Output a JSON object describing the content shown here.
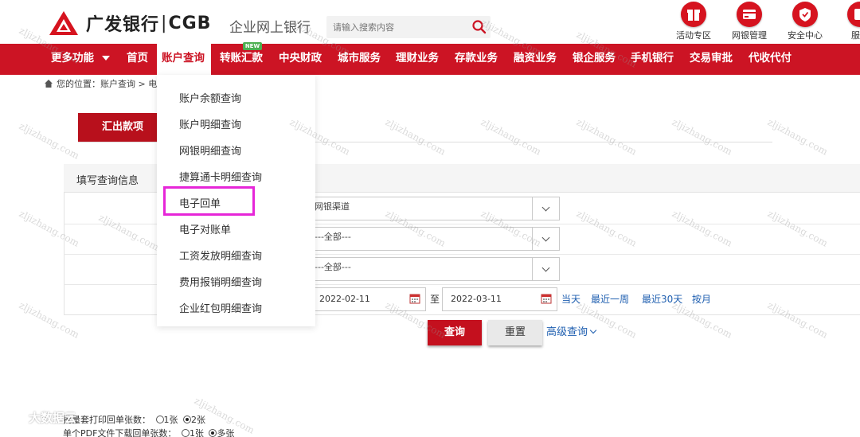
{
  "header": {
    "logo_cn": "广发银行",
    "logo_sep": "|",
    "logo_en": "CGB",
    "site_name": "企业网上银行",
    "search_placeholder": "请输入搜索内容",
    "quick_links": [
      {
        "label": "活动专区",
        "icon": "gift-icon"
      },
      {
        "label": "网银管理",
        "icon": "card-manage-icon"
      },
      {
        "label": "安全中心",
        "icon": "shield-icon"
      },
      {
        "label": "服务",
        "icon": "service-icon"
      }
    ]
  },
  "nav": {
    "more": "更多功能",
    "items": [
      "首页",
      "账户查询",
      "转账汇款",
      "中央财政",
      "城市服务",
      "理财业务",
      "存款业务",
      "融资业务",
      "银企服务",
      "手机银行",
      "交易审批",
      "代收代付"
    ],
    "new_badge": "NEW",
    "active": "账户查询"
  },
  "breadcrumb": {
    "text": "您的位置：账户查询 > 电"
  },
  "main": {
    "tab": "汇出款项",
    "form_title": "填写查询信息",
    "fields": {
      "channel": "网银渠道",
      "select2": "---全部---",
      "select3": "---全部---",
      "date_from": "2022-02-11",
      "date_sep": "至",
      "date_to": "2022-03-11"
    },
    "quick_dates": [
      "当天",
      "最近一周",
      "最近30天",
      "按月"
    ],
    "query_btn": "查询",
    "reset_btn": "重置",
    "advanced": "高级查询"
  },
  "dropdown": {
    "items": [
      "账户余额查询",
      "账户明细查询",
      "网银明细查询",
      "捷算通卡明细查询",
      "电子回单",
      "电子对账单",
      "工资发放明细查询",
      "费用报销明细查询",
      "企业红包明细查询"
    ],
    "highlighted": "电子回单"
  },
  "bottom": {
    "line1_label": "批量套打印回单张数：",
    "line1_opts": [
      "1张",
      "2张"
    ],
    "line2_label": "单个PDF文件下载回单张数：",
    "line2_opts": [
      "1张",
      "多张"
    ],
    "wechat": "大数据云"
  },
  "watermark": "zljizhang.com",
  "colors": {
    "brand_red": "#cc1424",
    "link_blue": "#1f5fb0",
    "highlight_magenta": "#e626d8"
  }
}
